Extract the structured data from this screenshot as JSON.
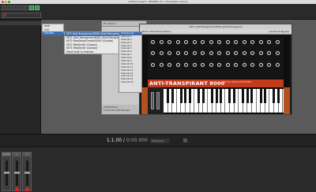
{
  "titlebar": {
    "title": "untitled project - REAPER v5.x - Evaluation license"
  },
  "menu1": {
    "items": [
      "Instr",
      "Cntl",
      "Monitor"
    ]
  },
  "menu2": {
    "items": [
      "VST: Anti-Transpirant 8000 (Anti-Transpirant)",
      "VSTi: Anti-Transpirant 8000 (Anti-Transpirant)",
      "VSTi: ReaSamplOmatic5000 (Cockos)",
      "VSTi: ReaSynth (Cockos)",
      "VSTi: ReaSynDr (Cockos)",
      "Show built-in channel"
    ]
  },
  "menu3": {
    "items": [
      "All Channels",
      "Channel 1",
      "Channel 2",
      "Channel 3",
      "Channel 4",
      "Channel 5",
      "Channel 6",
      "Channel 7",
      "Channel 8",
      "Channel 9",
      "Channel 10",
      "Channel 11",
      "Channel 12",
      "Channel 13",
      "Channel 14",
      "Channel 15",
      "Channel 16"
    ]
  },
  "fx_window": {
    "title": "FX: Track 1",
    "footer": "Add  Remove",
    "cpu": "2.3%/3.2% CPU 0/0 spls"
  },
  "plugin": {
    "title": "VSTi: Anti-Transpirant 8000 (Anti-Transpirant)",
    "toolbar_left": "Param  Edit  Preset  Options",
    "toolbar_right": "+ Param  UI  Bypass",
    "brand": "ANTI-TRANSPIRANT 8000",
    "brand_sub": "VIRTUAL ANALOG SYNTHESIZER"
  },
  "transport": {
    "time_beats": "1.1.00",
    "time_sep": " / ",
    "time_seconds": "0:00.000",
    "state": "[Stopped]"
  },
  "mixer": {
    "strips": [
      "MASTER",
      "1",
      "2"
    ]
  },
  "colors": {
    "nameplate": "#c43a1c",
    "wood": "#b3521e",
    "menu_highlight": "#3b6fb4",
    "record": "#dd2222"
  }
}
